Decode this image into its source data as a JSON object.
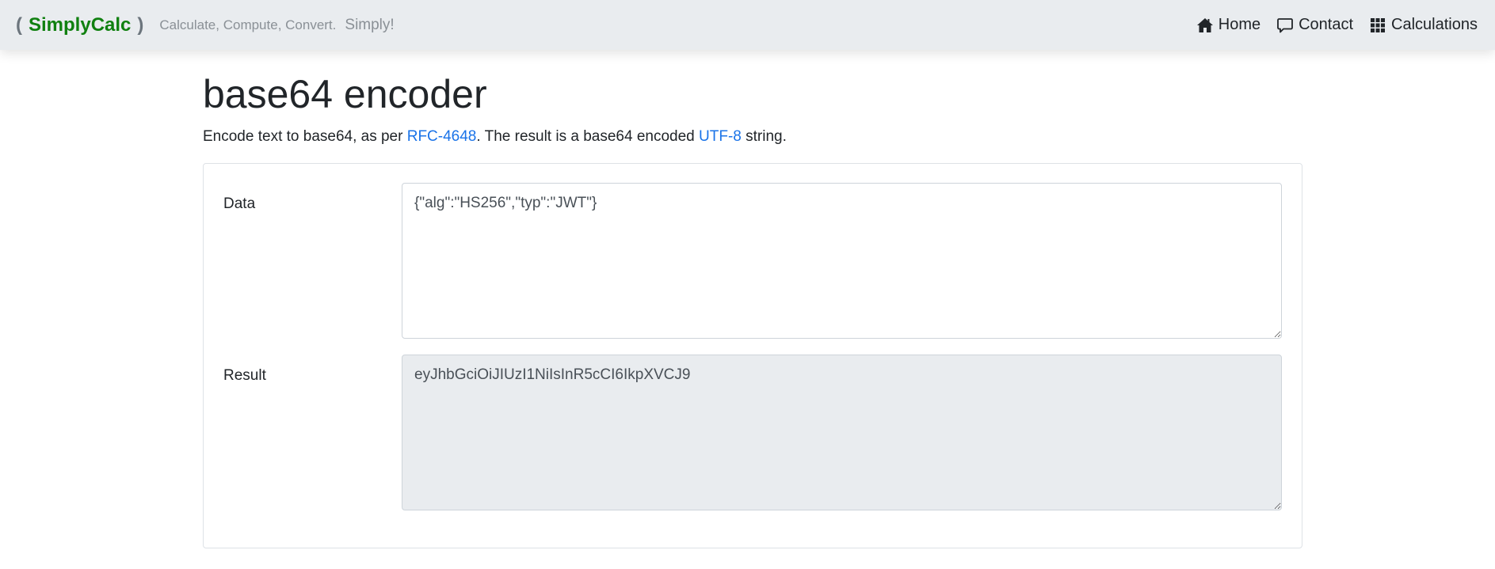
{
  "navbar": {
    "brand_open": "(",
    "brand_name": "SimplyCalc",
    "brand_close": ")",
    "tagline": "Calculate, Compute, Convert.",
    "tagline_simply": "Simply!",
    "links": [
      {
        "label": "Home",
        "icon": "home-icon"
      },
      {
        "label": "Contact",
        "icon": "chat-bubble-icon"
      },
      {
        "label": "Calculations",
        "icon": "grid-icon"
      }
    ]
  },
  "page": {
    "title": "base64 encoder",
    "lead_part1": "Encode text to base64, as per ",
    "lead_link1": "RFC-4648",
    "lead_part2": ". The result is a base64 encoded ",
    "lead_link2": "UTF-8",
    "lead_part3": " string."
  },
  "form": {
    "data_label": "Data",
    "data_value": "{\"alg\":\"HS256\",\"typ\":\"JWT\"}",
    "result_label": "Result",
    "result_value": "eyJhbGciOiJIUzI1NiIsInR5cCI6IkpXVCJ9"
  }
}
